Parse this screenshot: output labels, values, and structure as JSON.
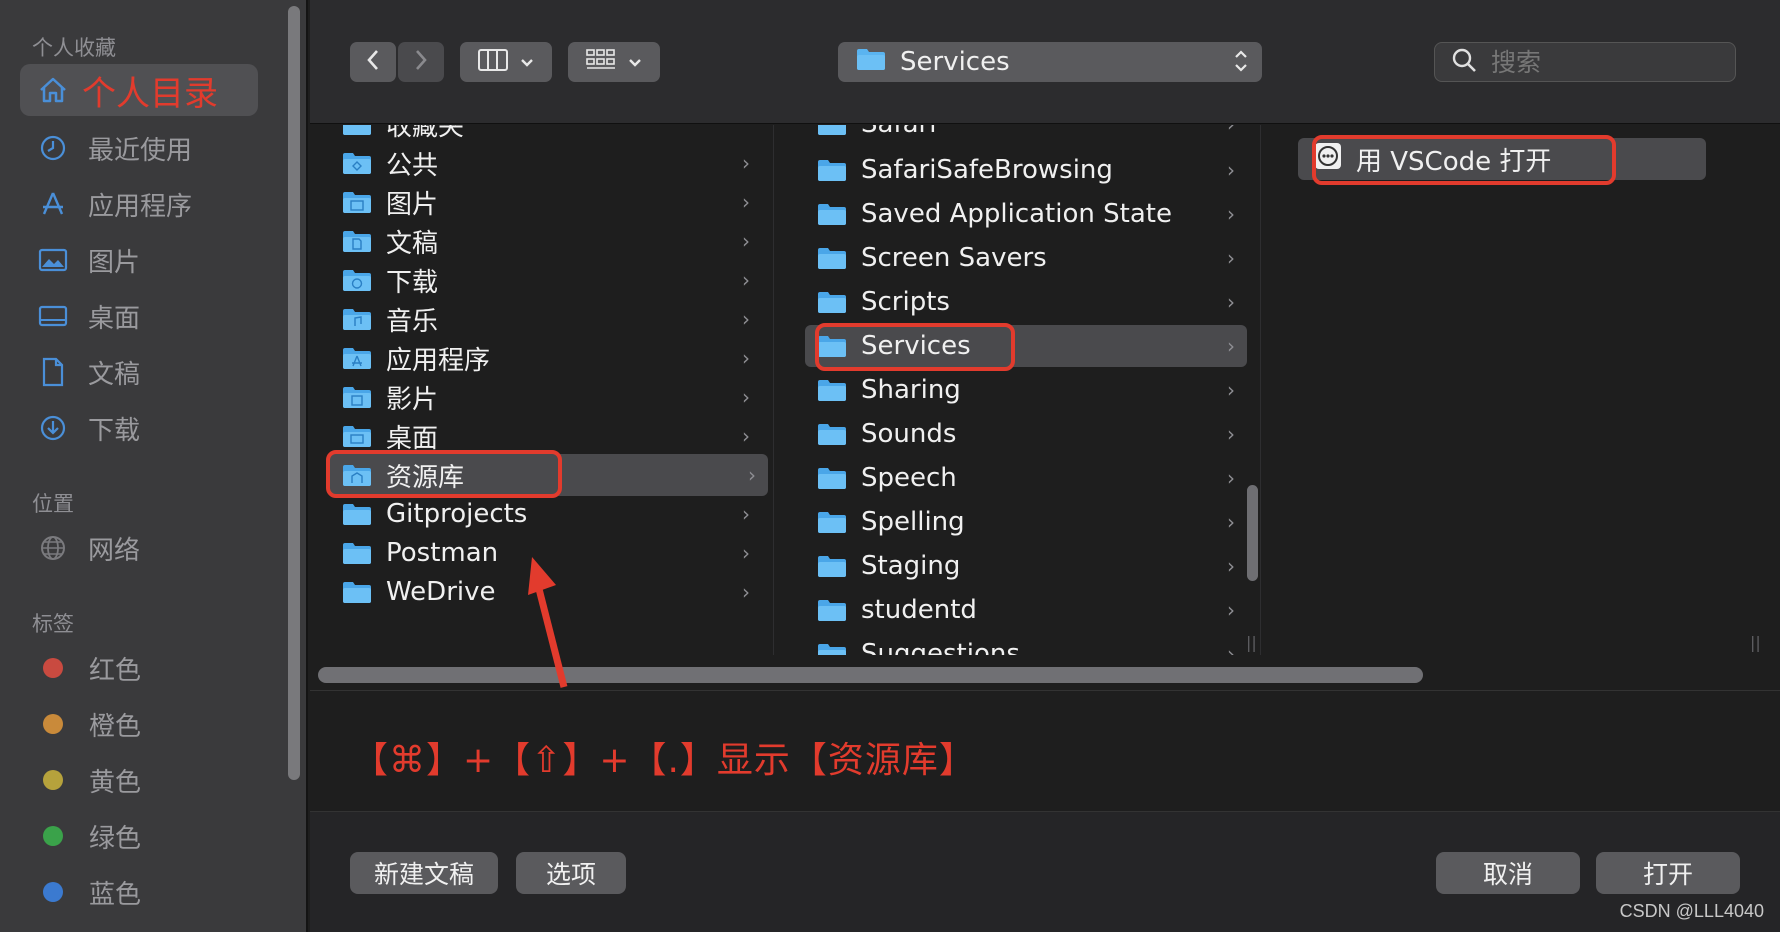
{
  "sidebar": {
    "favorites_title": "个人收藏",
    "favorites": [
      {
        "label": "个人目录",
        "icon": "house-icon",
        "selected": true
      },
      {
        "label": "最近使用",
        "icon": "clock-icon"
      },
      {
        "label": "应用程序",
        "icon": "apps-icon"
      },
      {
        "label": "图片",
        "icon": "photo-icon"
      },
      {
        "label": "桌面",
        "icon": "desktop-icon"
      },
      {
        "label": "文稿",
        "icon": "document-icon"
      },
      {
        "label": "下载",
        "icon": "download-icon"
      }
    ],
    "locations_title": "位置",
    "locations": [
      {
        "label": "网络",
        "icon": "globe-icon"
      }
    ],
    "tags_title": "标签",
    "tags": [
      {
        "label": "红色",
        "color": "#c94a40"
      },
      {
        "label": "橙色",
        "color": "#c98a3a"
      },
      {
        "label": "黄色",
        "color": "#b6a23c"
      },
      {
        "label": "绿色",
        "color": "#3aa24a"
      },
      {
        "label": "蓝色",
        "color": "#3b7ad0"
      }
    ]
  },
  "toolbar": {
    "path": "Services",
    "search_placeholder": "搜索"
  },
  "columns": {
    "col1": [
      {
        "label": "收藏夹"
      },
      {
        "label": "公共"
      },
      {
        "label": "图片"
      },
      {
        "label": "文稿"
      },
      {
        "label": "下载"
      },
      {
        "label": "音乐"
      },
      {
        "label": "应用程序"
      },
      {
        "label": "影片"
      },
      {
        "label": "桌面"
      },
      {
        "label": "资源库",
        "selected": true
      },
      {
        "label": "Gitprojects"
      },
      {
        "label": "Postman"
      },
      {
        "label": "WeDrive"
      }
    ],
    "col2": [
      {
        "label": "Safari"
      },
      {
        "label": "SafariSafeBrowsing"
      },
      {
        "label": "Saved Application State"
      },
      {
        "label": "Screen Savers"
      },
      {
        "label": "Scripts"
      },
      {
        "label": "Services",
        "selected": true
      },
      {
        "label": "Sharing"
      },
      {
        "label": "Sounds"
      },
      {
        "label": "Speech"
      },
      {
        "label": "Spelling"
      },
      {
        "label": "Staging"
      },
      {
        "label": "studentd"
      },
      {
        "label": "Suggestions"
      }
    ],
    "col3": [
      {
        "label": "用 VSCode 打开",
        "selected": true
      }
    ]
  },
  "annotation": "【⌘】+【⇧】+【.】显示【资源库】",
  "bottom": {
    "new_doc": "新建文稿",
    "options": "选项",
    "cancel": "取消",
    "open": "打开"
  },
  "watermark": "CSDN @LLL4040",
  "colors": {
    "accent_red": "#e23b2d",
    "folder_blue": "#5ab4f0"
  }
}
